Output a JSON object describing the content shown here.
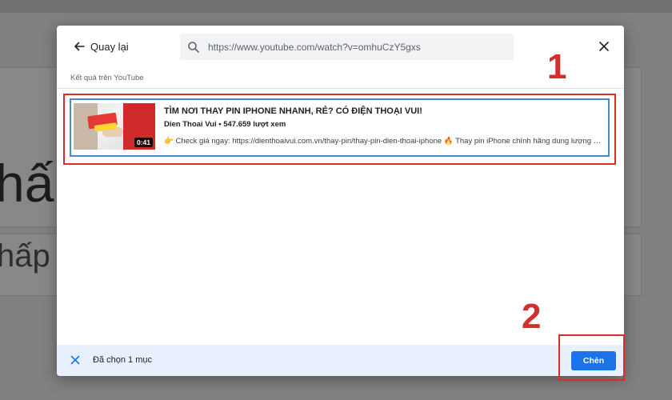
{
  "background": {
    "heading_fragment": "hấ",
    "subheading_fragment": "hấp đ"
  },
  "dialog": {
    "back_label": "Quay lại",
    "search": {
      "value": "https://www.youtube.com/watch?v=omhuCzY5gxs",
      "placeholder": ""
    },
    "section_label": "Kết quả trên YouTube",
    "result": {
      "title": "TÌM NƠI THAY PIN IPHONE NHANH, RẺ? CÓ ĐIỆN THOẠI VUI!",
      "meta": "Dien Thoai Vui • 547.659 lượt xem",
      "description": "👉 Check giá ngay: https://dienthoaivui.com.vn/thay-pin/thay-pin-dien-thoai-iphone 🔥 Thay pin iPhone chính hãng dung lượng cực...",
      "duration": "0:41"
    },
    "footer": {
      "selected_label": "Đã chọn 1 mục",
      "insert_label": "Chèn"
    }
  },
  "annotations": {
    "step_1": "1",
    "step_2": "2",
    "highlight_color": "#d32f2f"
  },
  "colors": {
    "accent": "#1a73e8",
    "footer_bg": "#e8f0fe",
    "selection_border": "#4a8ac8"
  }
}
